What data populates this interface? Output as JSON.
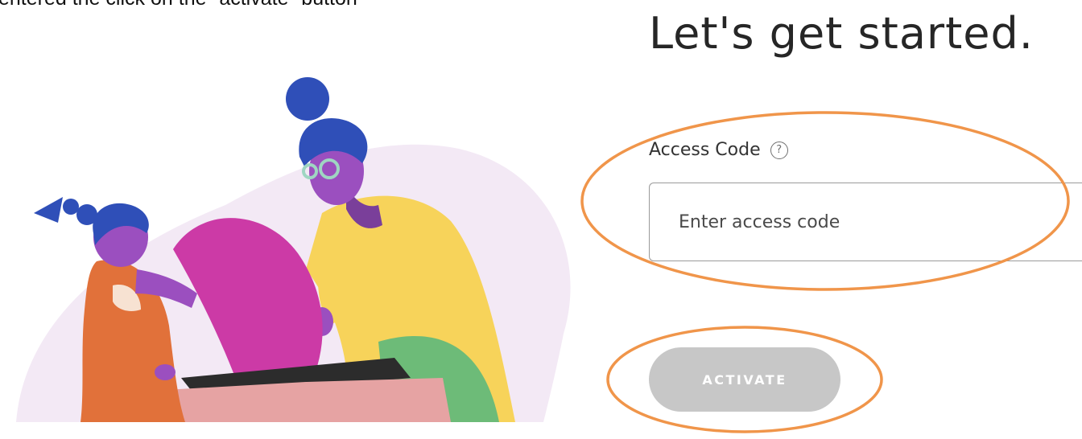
{
  "caption": "entered the click on the \"activate\" button",
  "title": "Let's get started.",
  "access_code": {
    "label": "Access Code",
    "help_glyph": "?",
    "placeholder": "Enter access code",
    "value": ""
  },
  "activate": {
    "label": "ACTIVATE",
    "state": "disabled"
  },
  "illustration": {
    "subject": "two figures opening a box",
    "colors": {
      "backdrop": "#f3e9f5",
      "hair": "#2f4fb8",
      "skin": "#9b4fbf",
      "lid": "#cc3aa6",
      "jacket": "#f7d35a",
      "pants": "#6dbb78",
      "overalls": "#e1713a",
      "box": "#e6a3a3",
      "box_inside": "#2c2c2c"
    }
  },
  "annotation": {
    "color": "#f0954a",
    "marks": [
      "circle around access code field",
      "circle around activate button"
    ]
  }
}
